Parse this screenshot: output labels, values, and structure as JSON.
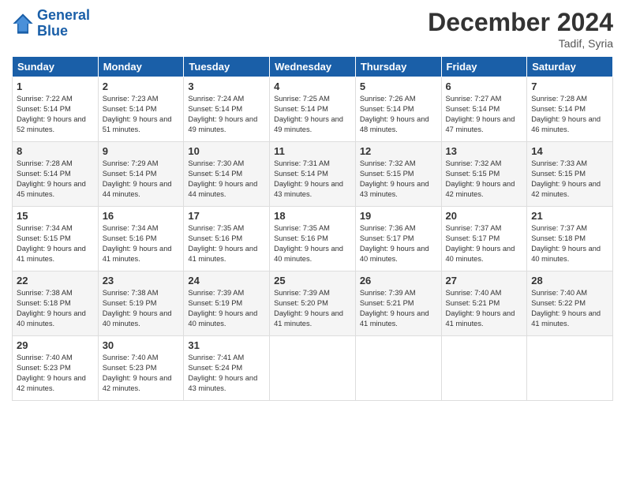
{
  "logo": {
    "line1": "General",
    "line2": "Blue"
  },
  "title": "December 2024",
  "location": "Tadif, Syria",
  "headers": [
    "Sunday",
    "Monday",
    "Tuesday",
    "Wednesday",
    "Thursday",
    "Friday",
    "Saturday"
  ],
  "weeks": [
    [
      {
        "day": "1",
        "sunrise": "7:22 AM",
        "sunset": "5:14 PM",
        "daylight": "9 hours and 52 minutes."
      },
      {
        "day": "2",
        "sunrise": "7:23 AM",
        "sunset": "5:14 PM",
        "daylight": "9 hours and 51 minutes."
      },
      {
        "day": "3",
        "sunrise": "7:24 AM",
        "sunset": "5:14 PM",
        "daylight": "9 hours and 49 minutes."
      },
      {
        "day": "4",
        "sunrise": "7:25 AM",
        "sunset": "5:14 PM",
        "daylight": "9 hours and 49 minutes."
      },
      {
        "day": "5",
        "sunrise": "7:26 AM",
        "sunset": "5:14 PM",
        "daylight": "9 hours and 48 minutes."
      },
      {
        "day": "6",
        "sunrise": "7:27 AM",
        "sunset": "5:14 PM",
        "daylight": "9 hours and 47 minutes."
      },
      {
        "day": "7",
        "sunrise": "7:28 AM",
        "sunset": "5:14 PM",
        "daylight": "9 hours and 46 minutes."
      }
    ],
    [
      {
        "day": "8",
        "sunrise": "7:28 AM",
        "sunset": "5:14 PM",
        "daylight": "9 hours and 45 minutes."
      },
      {
        "day": "9",
        "sunrise": "7:29 AM",
        "sunset": "5:14 PM",
        "daylight": "9 hours and 44 minutes."
      },
      {
        "day": "10",
        "sunrise": "7:30 AM",
        "sunset": "5:14 PM",
        "daylight": "9 hours and 44 minutes."
      },
      {
        "day": "11",
        "sunrise": "7:31 AM",
        "sunset": "5:14 PM",
        "daylight": "9 hours and 43 minutes."
      },
      {
        "day": "12",
        "sunrise": "7:32 AM",
        "sunset": "5:15 PM",
        "daylight": "9 hours and 43 minutes."
      },
      {
        "day": "13",
        "sunrise": "7:32 AM",
        "sunset": "5:15 PM",
        "daylight": "9 hours and 42 minutes."
      },
      {
        "day": "14",
        "sunrise": "7:33 AM",
        "sunset": "5:15 PM",
        "daylight": "9 hours and 42 minutes."
      }
    ],
    [
      {
        "day": "15",
        "sunrise": "7:34 AM",
        "sunset": "5:15 PM",
        "daylight": "9 hours and 41 minutes."
      },
      {
        "day": "16",
        "sunrise": "7:34 AM",
        "sunset": "5:16 PM",
        "daylight": "9 hours and 41 minutes."
      },
      {
        "day": "17",
        "sunrise": "7:35 AM",
        "sunset": "5:16 PM",
        "daylight": "9 hours and 41 minutes."
      },
      {
        "day": "18",
        "sunrise": "7:35 AM",
        "sunset": "5:16 PM",
        "daylight": "9 hours and 40 minutes."
      },
      {
        "day": "19",
        "sunrise": "7:36 AM",
        "sunset": "5:17 PM",
        "daylight": "9 hours and 40 minutes."
      },
      {
        "day": "20",
        "sunrise": "7:37 AM",
        "sunset": "5:17 PM",
        "daylight": "9 hours and 40 minutes."
      },
      {
        "day": "21",
        "sunrise": "7:37 AM",
        "sunset": "5:18 PM",
        "daylight": "9 hours and 40 minutes."
      }
    ],
    [
      {
        "day": "22",
        "sunrise": "7:38 AM",
        "sunset": "5:18 PM",
        "daylight": "9 hours and 40 minutes."
      },
      {
        "day": "23",
        "sunrise": "7:38 AM",
        "sunset": "5:19 PM",
        "daylight": "9 hours and 40 minutes."
      },
      {
        "day": "24",
        "sunrise": "7:39 AM",
        "sunset": "5:19 PM",
        "daylight": "9 hours and 40 minutes."
      },
      {
        "day": "25",
        "sunrise": "7:39 AM",
        "sunset": "5:20 PM",
        "daylight": "9 hours and 41 minutes."
      },
      {
        "day": "26",
        "sunrise": "7:39 AM",
        "sunset": "5:21 PM",
        "daylight": "9 hours and 41 minutes."
      },
      {
        "day": "27",
        "sunrise": "7:40 AM",
        "sunset": "5:21 PM",
        "daylight": "9 hours and 41 minutes."
      },
      {
        "day": "28",
        "sunrise": "7:40 AM",
        "sunset": "5:22 PM",
        "daylight": "9 hours and 41 minutes."
      }
    ],
    [
      {
        "day": "29",
        "sunrise": "7:40 AM",
        "sunset": "5:23 PM",
        "daylight": "9 hours and 42 minutes."
      },
      {
        "day": "30",
        "sunrise": "7:40 AM",
        "sunset": "5:23 PM",
        "daylight": "9 hours and 42 minutes."
      },
      {
        "day": "31",
        "sunrise": "7:41 AM",
        "sunset": "5:24 PM",
        "daylight": "9 hours and 43 minutes."
      },
      null,
      null,
      null,
      null
    ]
  ]
}
